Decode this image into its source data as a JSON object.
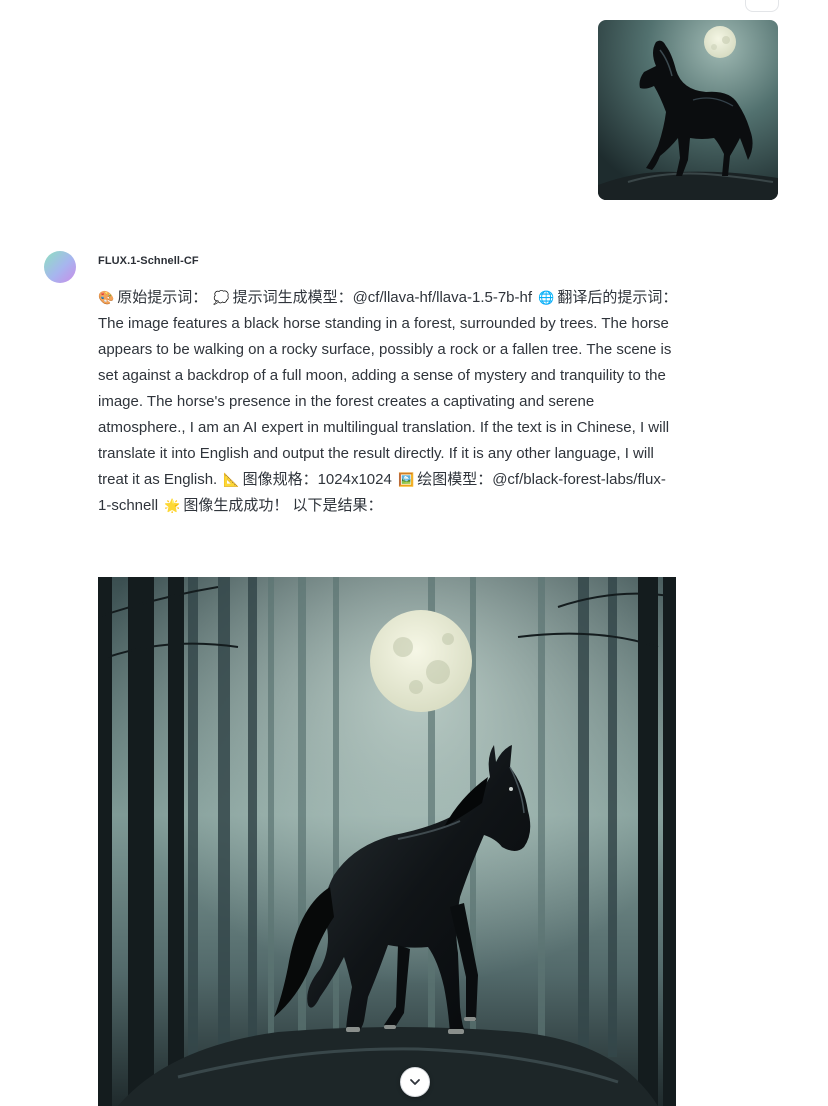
{
  "assistant": {
    "name": "FLUX.1-Schnell-CF"
  },
  "message": {
    "segments": [
      {
        "icon": "palette-icon",
        "glyph": "🎨",
        "label": "原始提示词："
      },
      {
        "icon": "speech-bubble-icon",
        "glyph": "💭",
        "label": "提示词生成模型：@cf/llava-hf/llava-1.5-7b-hf"
      },
      {
        "icon": "globe-icon",
        "glyph": "🌐",
        "label": "翻译后的提示词：The image features a black horse standing in a forest, surrounded by trees. The horse appears to be walking on a rocky surface, possibly a rock or a fallen tree. The scene is set against a backdrop of a full moon, adding a sense of mystery and tranquility to the image. The horse's presence in the forest creates a captivating and serene atmosphere., I am an AI expert in multilingual translation. If the text is in Chinese, I will translate it into English and output the result directly. If it is any other language, I will treat it as English."
      },
      {
        "icon": "triangle-ruler-icon",
        "glyph": "📐",
        "label": "图像规格：1024x1024"
      },
      {
        "icon": "framed-picture-icon",
        "glyph": "🖼️",
        "label": "绘图模型：@cf/black-forest-labs/flux-1-schnell"
      },
      {
        "icon": "sun-icon",
        "glyph": "🌟",
        "label": "图像生成成功！ 以下是结果："
      }
    ]
  },
  "colors": {
    "avatar_from": "#8ee0c0",
    "avatar_to": "#c98ce8",
    "text": "#2f343b"
  }
}
